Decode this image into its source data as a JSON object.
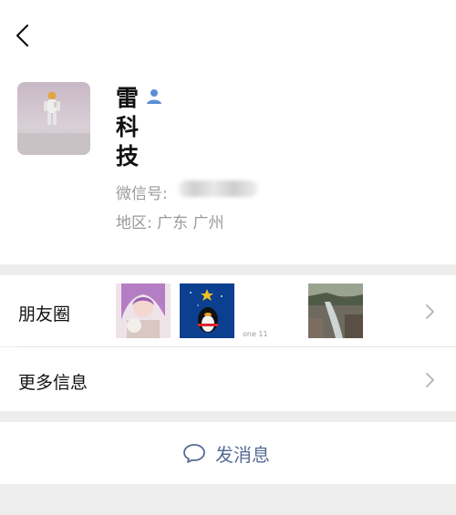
{
  "header": {
    "back_icon": "chevron-left-icon"
  },
  "profile": {
    "name": "雷科技",
    "verified_icon": "person-icon",
    "wechat_id_label": "微信号:",
    "region_label": "地区:",
    "region_value": "广东  广州"
  },
  "moments": {
    "label": "朋友圈",
    "thumbnail_caption": "one 11"
  },
  "more_info": {
    "label": "更多信息"
  },
  "actions": {
    "send_message_label": "发消息"
  },
  "colors": {
    "link_blue": "#576b95",
    "accent_blue": "#5a8fd6"
  }
}
